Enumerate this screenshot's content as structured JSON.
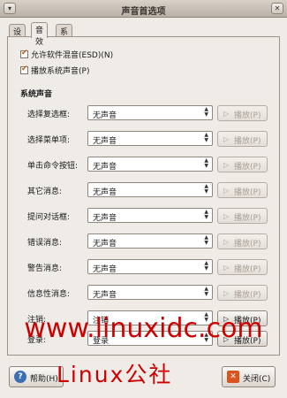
{
  "window": {
    "title": "声音首选项"
  },
  "tabs": [
    "设备",
    "音效",
    "系统响铃"
  ],
  "options": [
    {
      "label": "允许软件混音(ESD)(N)",
      "checked": true
    },
    {
      "label": "播放系统声音(P)",
      "checked": true
    }
  ],
  "section_title": "系统声音",
  "sounds": [
    {
      "label": "选择复选框:",
      "value": "无声音",
      "play": "播放(P)",
      "enabled": false
    },
    {
      "label": "选择菜单项:",
      "value": "无声音",
      "play": "播放(P)",
      "enabled": false
    },
    {
      "label": "单击命令按钮:",
      "value": "无声音",
      "play": "播放(P)",
      "enabled": false
    },
    {
      "label": "其它消息:",
      "value": "无声音",
      "play": "播放(P)",
      "enabled": false
    },
    {
      "label": "提问对话框:",
      "value": "无声音",
      "play": "播放(P)",
      "enabled": false
    },
    {
      "label": "错误消息:",
      "value": "无声音",
      "play": "播放(P)",
      "enabled": false
    },
    {
      "label": "警告消息:",
      "value": "无声音",
      "play": "播放(P)",
      "enabled": false
    },
    {
      "label": "信息性消息:",
      "value": "无声音",
      "play": "播放(P)",
      "enabled": false
    },
    {
      "label": "注销:",
      "value": "注销",
      "play": "播放(P)",
      "enabled": true
    },
    {
      "label": "登录:",
      "value": "登录",
      "play": "播放(P)",
      "enabled": true
    }
  ],
  "buttons": {
    "help": "帮助(H)",
    "close": "关闭(C)"
  },
  "watermark": {
    "url": "www.linuxidc.com",
    "text": "Linux公社"
  },
  "colors": {
    "checkmark": "#c2601f",
    "watermark": "#cc0000",
    "help_icon": "#3a6fb5",
    "close_icon": "#d9541e"
  }
}
